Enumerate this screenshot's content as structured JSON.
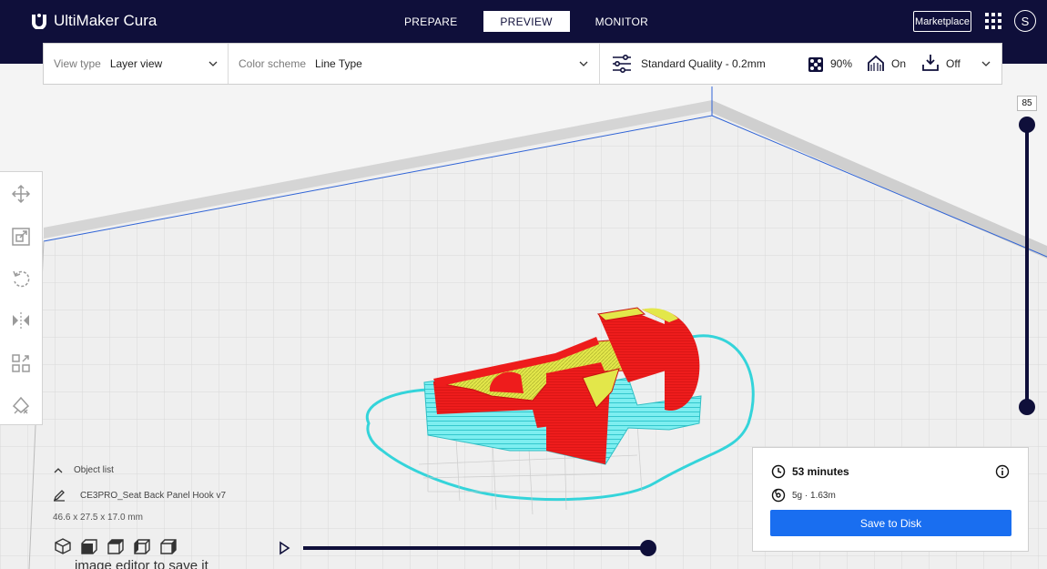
{
  "app": {
    "name": "UltiMaker Cura"
  },
  "stages": [
    {
      "label": "PREPARE",
      "active": false
    },
    {
      "label": "PREVIEW",
      "active": true
    },
    {
      "label": "MONITOR",
      "active": false
    }
  ],
  "header": {
    "marketplace_label": "Marketplace",
    "avatar_initial": "S",
    "apps_icon": "grid-icon"
  },
  "toolbar": {
    "view_type_label": "View type",
    "view_type_value": "Layer view",
    "color_scheme_label": "Color scheme",
    "color_scheme_value": "Line Type",
    "quality_label": "Standard Quality - 0.2mm",
    "infill_value": "90%",
    "support_value": "On",
    "adhesion_value": "Off"
  },
  "layer_slider": {
    "current_layer": "85",
    "fraction": 1.0
  },
  "objects": {
    "list_label": "Object list",
    "name": "CE3PRO_Seat Back Panel Hook v7",
    "dimensions": "46.6 x 27.5 x 17.0 mm"
  },
  "simulation": {
    "progress": 1.0
  },
  "summary": {
    "time": "53 minutes",
    "material": "5g · 1.63m",
    "save_label": "Save to Disk"
  },
  "overflow_text": "image editor to save it",
  "colors": {
    "header_bg": "#0f0f3a",
    "accent": "#196ef0",
    "wall_red": "#ee1c1c",
    "infill_yellow": "#e3e74a",
    "support_cyan": "#47e1e6"
  }
}
